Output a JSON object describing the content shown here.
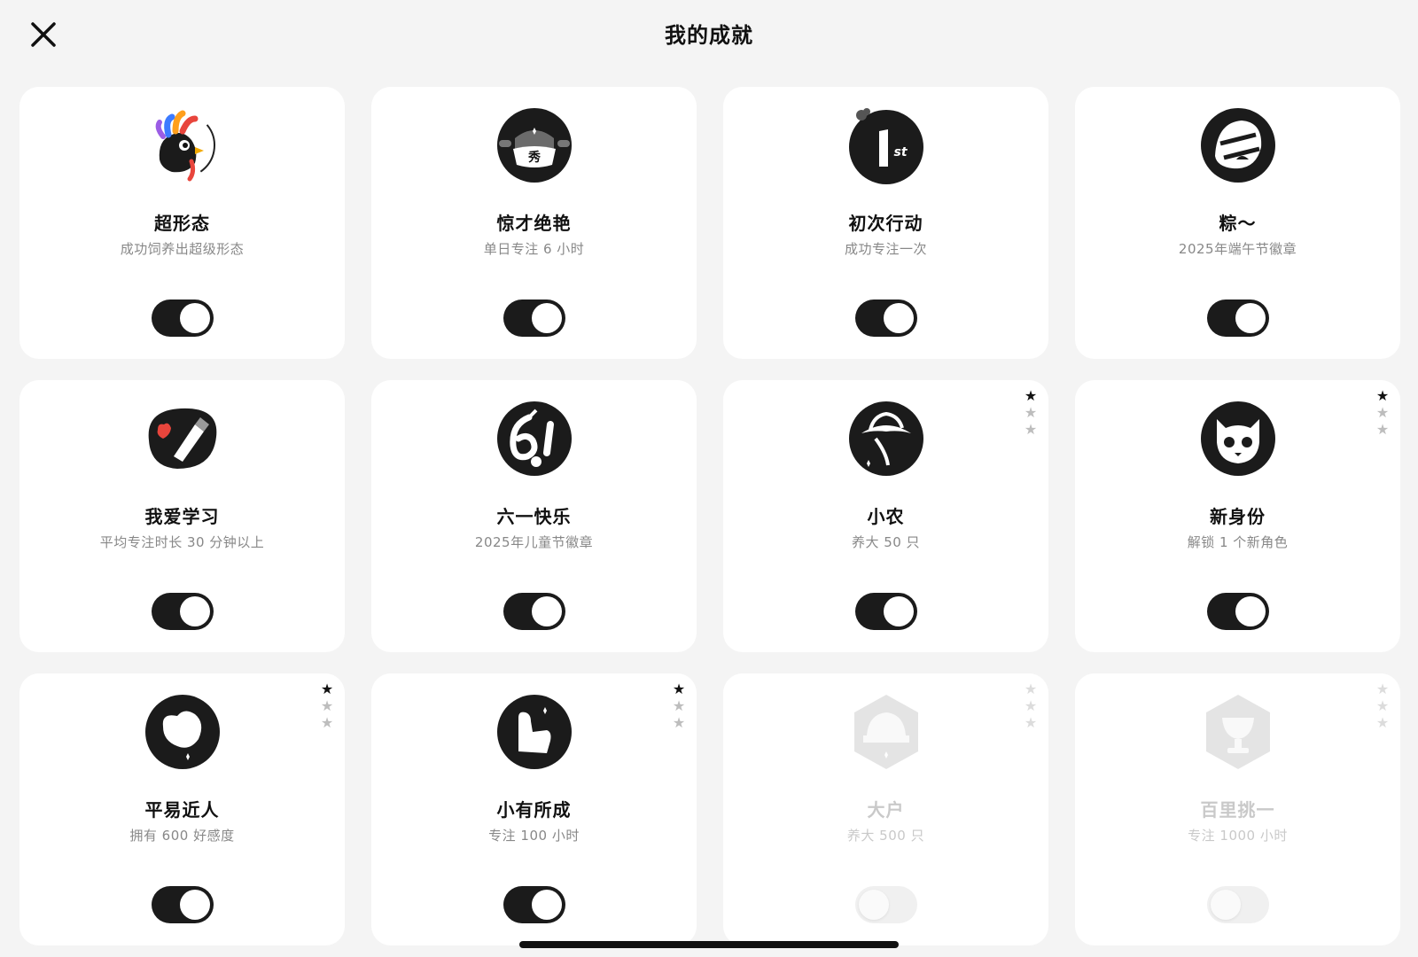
{
  "header": {
    "title": "我的成就",
    "close_icon": "close-icon"
  },
  "colors": {
    "background": "#f4f4f4",
    "card": "#ffffff",
    "toggle_on": "#1b1b1b",
    "toggle_off": "#f0f0f0",
    "star_filled": "#111111",
    "star_empty": "#bdbdbd"
  },
  "achievements": [
    {
      "name": "超形态",
      "desc": "成功饲养出超级形态",
      "icon": "rooster-icon",
      "enabled": true,
      "locked": false,
      "stars": null
    },
    {
      "name": "惊才绝艳",
      "desc": "单日专注 6 小时",
      "icon": "ushanka-hat-icon",
      "enabled": true,
      "locked": false,
      "stars": null
    },
    {
      "name": "初次行动",
      "desc": "成功专注一次",
      "icon": "first-place-icon",
      "enabled": true,
      "locked": false,
      "stars": null
    },
    {
      "name": "粽～",
      "desc": "2025年端午节徽章",
      "icon": "zongzi-icon",
      "enabled": true,
      "locked": false,
      "stars": null
    },
    {
      "name": "我爱学习",
      "desc": "平均专注时长 30 分钟以上",
      "icon": "pen-heart-icon",
      "enabled": true,
      "locked": false,
      "stars": null
    },
    {
      "name": "六一快乐",
      "desc": "2025年儿童节徽章",
      "icon": "sixty-one-icon",
      "enabled": true,
      "locked": false,
      "stars": null
    },
    {
      "name": "小农",
      "desc": "养大 50 只",
      "icon": "farmer-hat-icon",
      "enabled": true,
      "locked": false,
      "stars": 1
    },
    {
      "name": "新身份",
      "desc": "解锁 1 个新角色",
      "icon": "cat-mask-icon",
      "enabled": true,
      "locked": false,
      "stars": 1
    },
    {
      "name": "平易近人",
      "desc": "拥有 600 好感度",
      "icon": "heart-blob-icon",
      "enabled": true,
      "locked": false,
      "stars": 1
    },
    {
      "name": "小有所成",
      "desc": "专注 100 小时",
      "icon": "thumb-up-icon",
      "enabled": true,
      "locked": false,
      "stars": 1
    },
    {
      "name": "大户",
      "desc": "养大 500 只",
      "icon": "cap-icon",
      "enabled": false,
      "locked": true,
      "stars": 0
    },
    {
      "name": "百里挑一",
      "desc": "专注 1000 小时",
      "icon": "trophy-icon",
      "enabled": false,
      "locked": true,
      "stars": 0
    }
  ]
}
